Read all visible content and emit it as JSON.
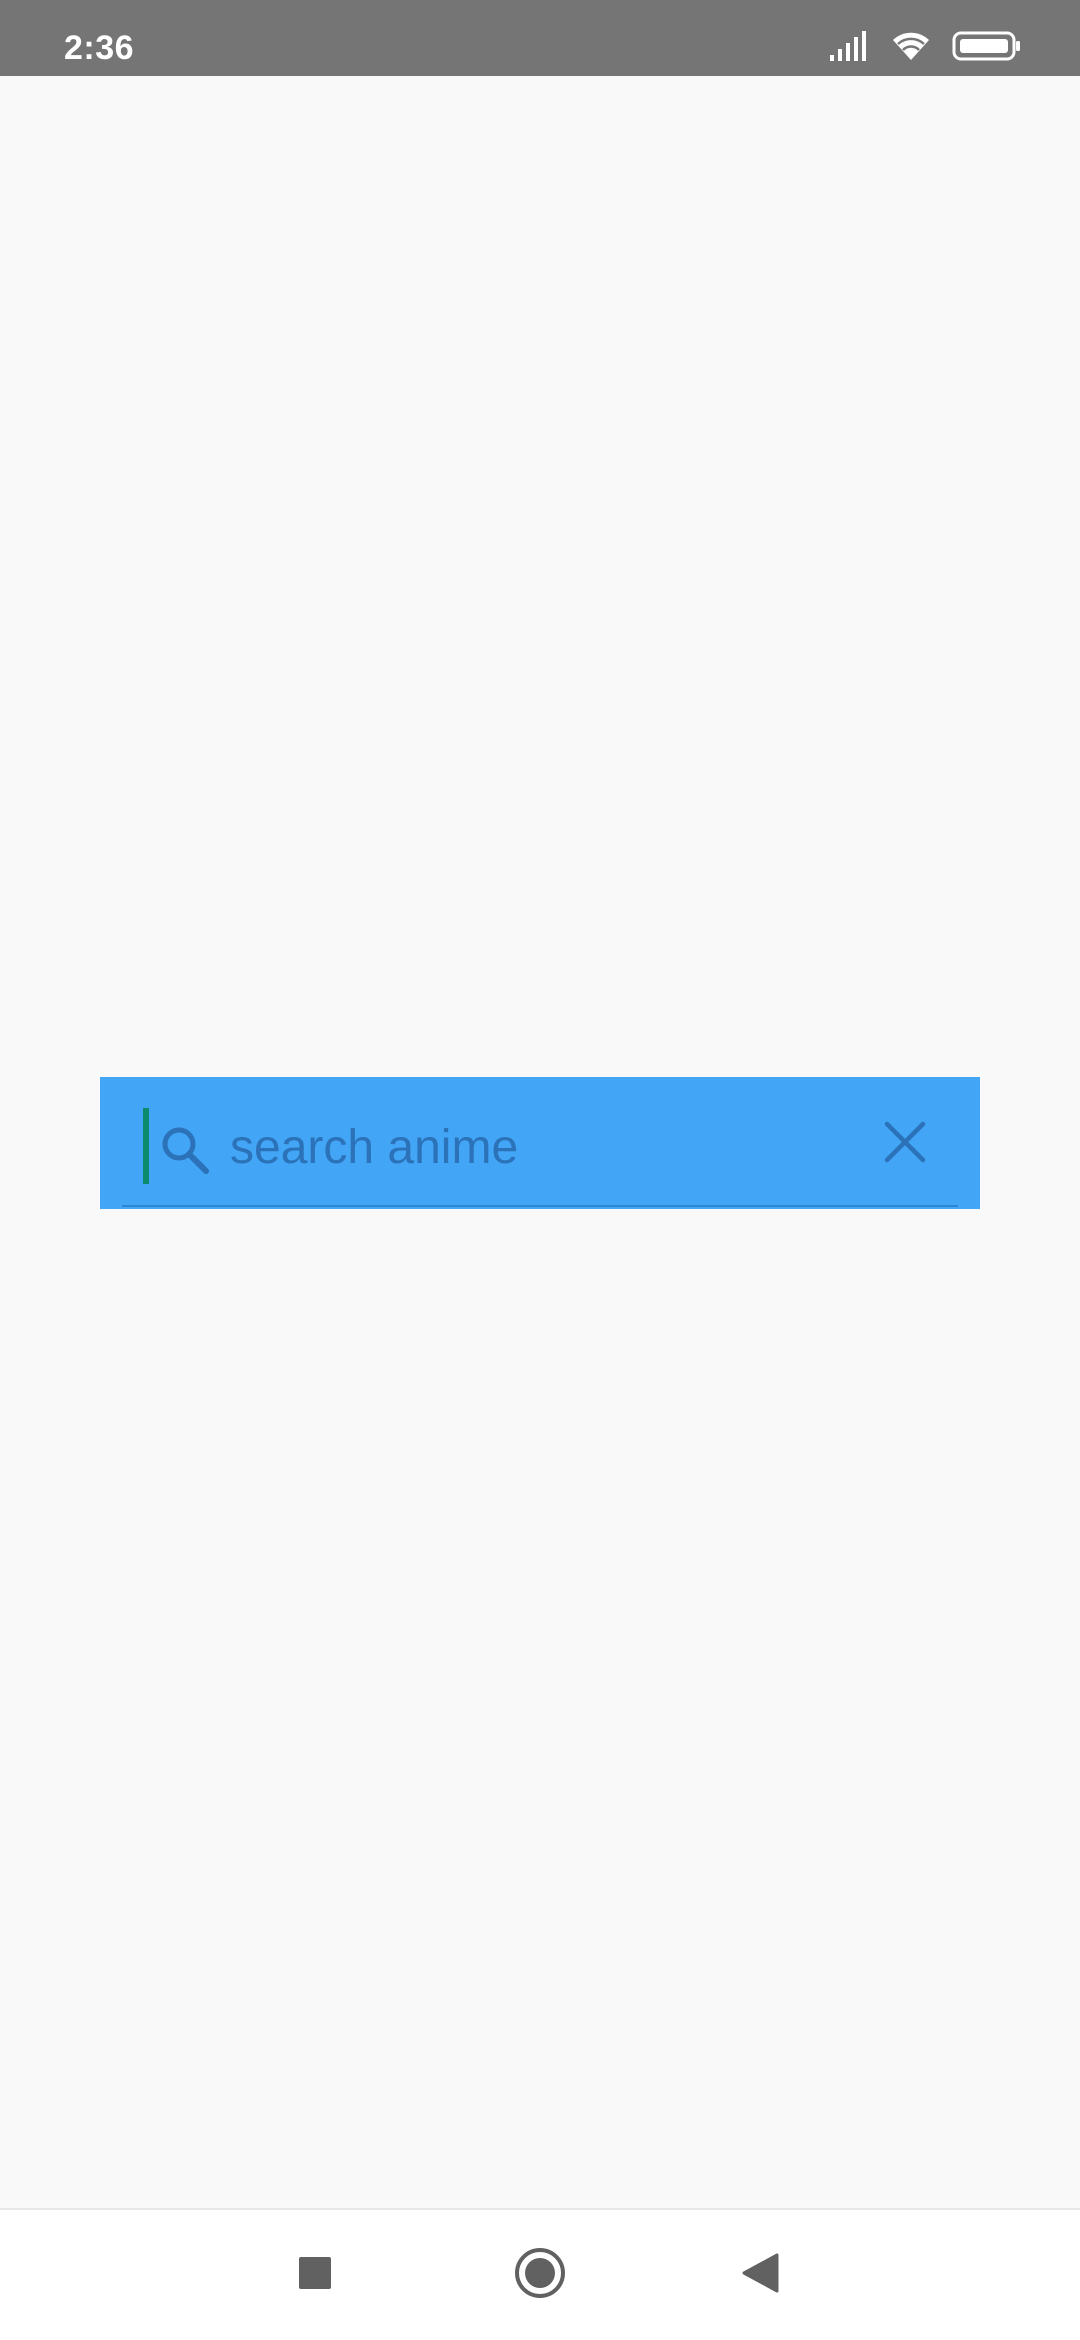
{
  "status_bar": {
    "time": "2:36",
    "icons": [
      "signal-icon",
      "wifi-icon",
      "battery-icon"
    ]
  },
  "search": {
    "placeholder": "search anime",
    "value": ""
  },
  "navigation": {
    "buttons": [
      "recents-square-icon",
      "home-circle-icon",
      "back-triangle-icon"
    ]
  },
  "colors": {
    "status_bar": "#757575",
    "background": "#f9f9f9",
    "search_background": "#42a5f5",
    "search_text": "#2b72b8",
    "caret": "#0c8a6e",
    "nav_icons": "#616161"
  }
}
